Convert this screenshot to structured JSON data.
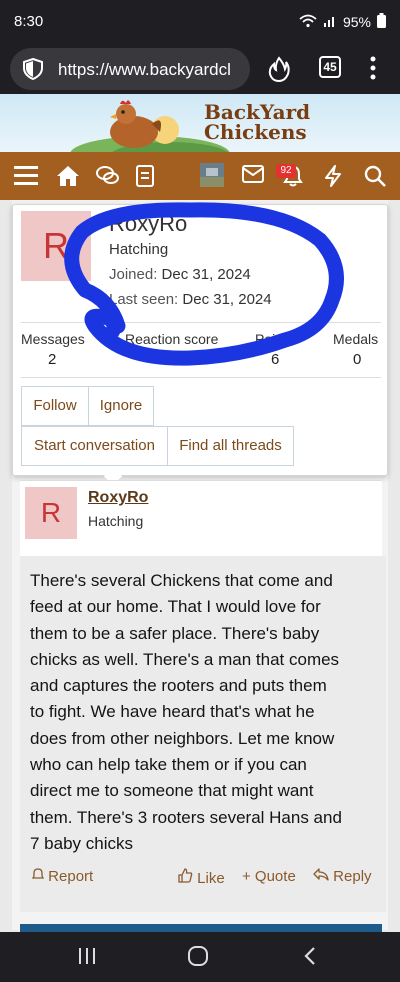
{
  "status_bar": {
    "time": "8:30",
    "battery": "95%"
  },
  "browser": {
    "url": "https://www.backyardcl",
    "tab_count": "45"
  },
  "banner": {
    "logo_line1": "BackYard",
    "logo_line2": "Chickens"
  },
  "navbar": {
    "alerts_badge": "92"
  },
  "profile_card": {
    "avatar_letter": "R",
    "username": "RoxyRo",
    "user_title": "Hatching",
    "joined_label": "Joined:",
    "joined_value": "Dec 31, 2024",
    "last_seen_label": "Last seen:",
    "last_seen_value": "Dec 31, 2024",
    "stats": [
      {
        "label": "Messages",
        "value": "2"
      },
      {
        "label": "Reaction score",
        "value": ""
      },
      {
        "label": "Points",
        "value": "6"
      },
      {
        "label": "Medals",
        "value": "0"
      }
    ],
    "buttons": {
      "follow": "Follow",
      "ignore": "Ignore",
      "start_conversation": "Start conversation",
      "find_threads": "Find all threads"
    }
  },
  "post": {
    "avatar_letter": "R",
    "username": "RoxyRo",
    "user_title": "Hatching",
    "lines": [
      "There's several Chickens that come and",
      "feed at our home. That I would love for",
      "them to be a safer place. There's baby",
      "chicks as well. There's a man that comes",
      "and captures the rooters and puts them",
      "to fight. We have heard that's what he",
      "does from other neighbors. Let me know",
      "who can help take them or if you can",
      "direct me to someone that might want",
      "them. There's 3 rooters several Hans and",
      "7 baby chicks"
    ],
    "actions": {
      "report": "Report",
      "like": "Like",
      "quote": "+ Quote",
      "reply": "Reply"
    }
  },
  "colors": {
    "nav_brown": "#a35f1f",
    "link_brown": "#7c4a1b",
    "scribble_blue": "#1b35e0"
  }
}
